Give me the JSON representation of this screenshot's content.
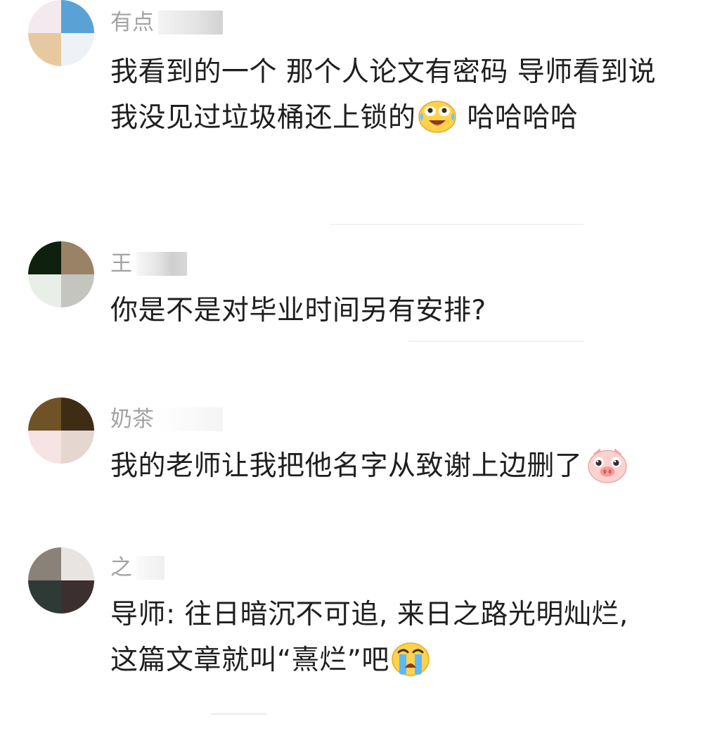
{
  "comments": [
    {
      "username": "有点",
      "text_parts": [
        "我看到的一个 那个人论文有密码 导师看到说 我没见过垃圾桶还上锁的",
        " 哈哈哈哈"
      ],
      "emoji": "laugh-cry-emoji"
    },
    {
      "username": "王",
      "text_parts": [
        "你是不是对毕业时间另有安排?"
      ]
    },
    {
      "username": "奶茶",
      "text_parts": [
        "我的老师让我把他名字从致谢上边删了"
      ],
      "emoji": "pig-face-emoji"
    },
    {
      "username": "之",
      "text_parts": [
        "导师: 往日暗沉不可追, 来日之路光明灿烂, 这篇文章就叫“熹烂”吧"
      ],
      "emoji": "crying-face-emoji"
    }
  ],
  "colors": {
    "text": "#1f1f1f",
    "username": "#a3a3a3",
    "background": "#ffffff"
  }
}
